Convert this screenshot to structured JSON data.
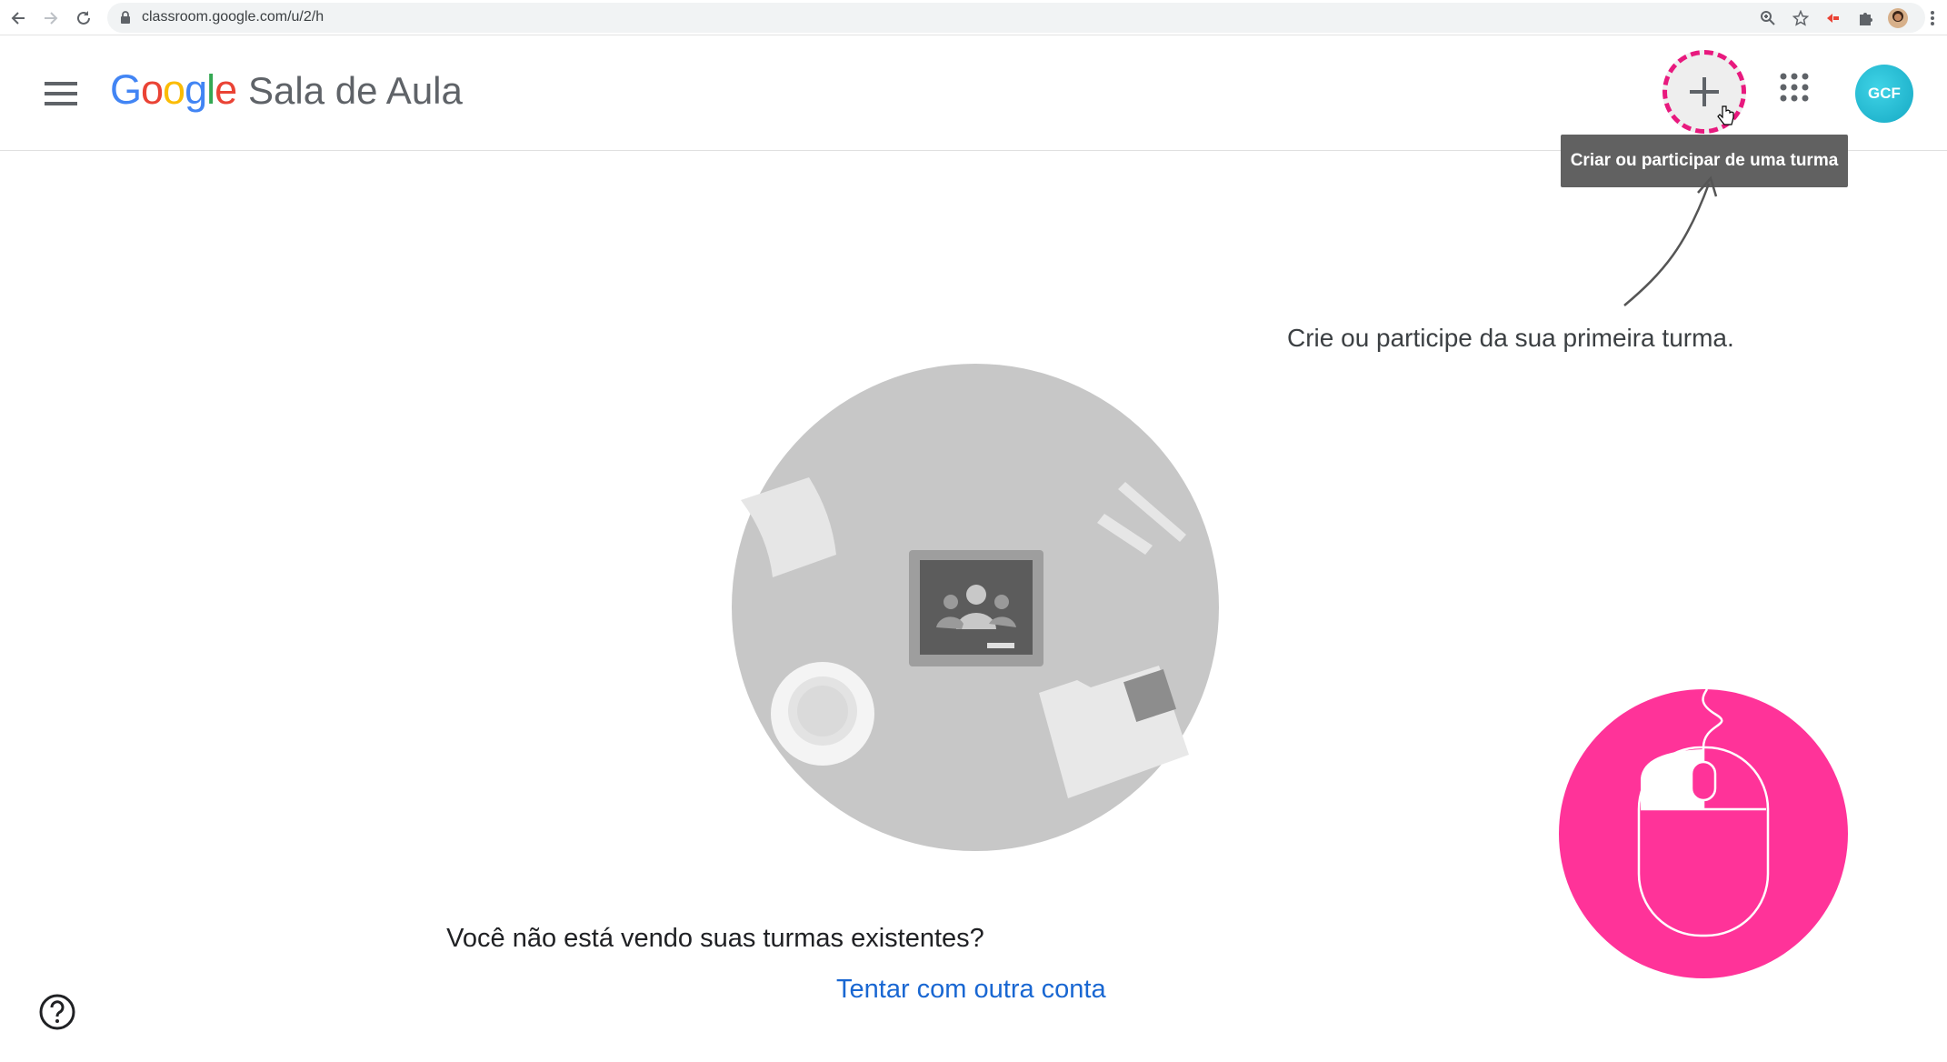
{
  "browser": {
    "url": "classroom.google.com/u/2/h"
  },
  "header": {
    "logo_letters": [
      {
        "ch": "G",
        "color": "#4285F4"
      },
      {
        "ch": "o",
        "color": "#EA4335"
      },
      {
        "ch": "o",
        "color": "#FBBC05"
      },
      {
        "ch": "g",
        "color": "#4285F4"
      },
      {
        "ch": "l",
        "color": "#34A853"
      },
      {
        "ch": "e",
        "color": "#EA4335"
      }
    ],
    "app_name": "Sala de Aula",
    "avatar_text": "GCF",
    "tooltip": "Criar ou participar de uma turma"
  },
  "main": {
    "hint": "Crie ou participe da sua primeira turma.",
    "question": "Você não está vendo suas turmas existentes?",
    "link": "Tentar com outra conta"
  },
  "colors": {
    "accent_pink": "#FF3399",
    "link_blue": "#1967D2",
    "tooltip_bg": "#616161"
  },
  "icons": [
    "back-arrow-icon",
    "forward-arrow-icon",
    "reload-icon",
    "lock-icon",
    "zoom-icon",
    "star-icon",
    "extension-icon",
    "puzzle-icon",
    "profile-icon",
    "more-vert-icon",
    "menu-icon",
    "plus-icon",
    "apps-grid-icon",
    "help-icon",
    "mouse-click-icon"
  ]
}
